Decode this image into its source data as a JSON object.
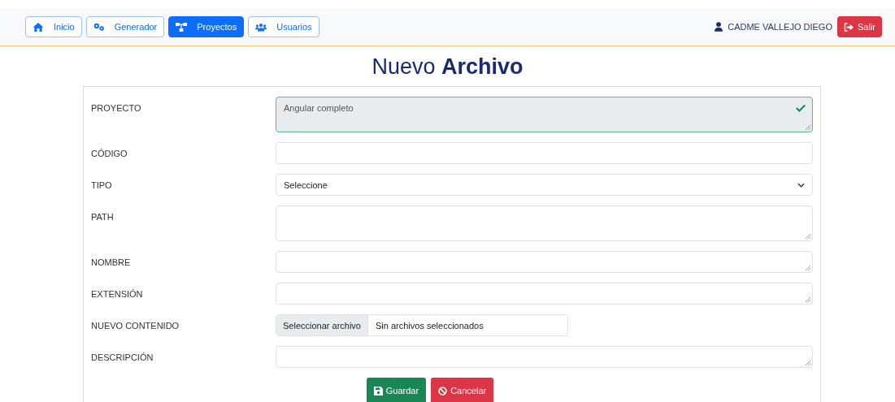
{
  "nav": {
    "tabs": [
      {
        "label": "Inicio",
        "selected": false
      },
      {
        "label": "Generador",
        "selected": false
      },
      {
        "label": "Proyectos",
        "selected": true
      },
      {
        "label": "Usuarios",
        "selected": false
      }
    ],
    "user": "CADME VALLEJO DIEGO",
    "logout": "Salir"
  },
  "title": "Nuevo **Archivo**",
  "fields": [
    {
      "label": "PROYECTO",
      "kind": "textarea",
      "value": "Angular completo",
      "disabled": true,
      "valid": true,
      "tall": true
    },
    {
      "label": "CÓDIGO",
      "kind": "input",
      "disabled": false,
      "valid": false,
      "tall": false
    },
    {
      "label": "TIPO",
      "kind": "select",
      "value": "Seleccione"
    },
    {
      "label": "PATH",
      "kind": "textarea",
      "disabled": false,
      "valid": false,
      "tall": true
    },
    {
      "label": "NOMBRE",
      "kind": "textarea",
      "disabled": false,
      "valid": false,
      "tall": false
    },
    {
      "label": "EXTENSIÓN",
      "kind": "textarea",
      "disabled": false,
      "valid": false,
      "tall": false
    },
    {
      "label": "NUEVO CONTENIDO",
      "kind": "file",
      "button": "Seleccionar archivo",
      "value": "Sin archivos seleccionados"
    },
    {
      "label": "DESCRIPCIÓN",
      "kind": "textarea",
      "disabled": false,
      "valid": false,
      "tall": false
    }
  ],
  "actions": [
    {
      "label": "Guardar",
      "kind": "save"
    },
    {
      "label": "Cancelar",
      "kind": "cancel"
    }
  ]
}
